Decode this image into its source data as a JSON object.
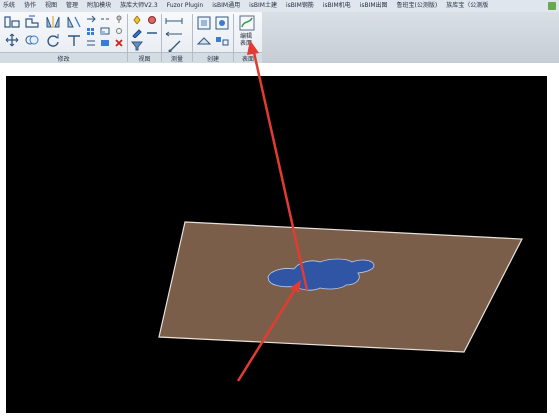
{
  "menu": {
    "items": [
      "乐统",
      "协作",
      "视图",
      "管理",
      "附加模块",
      "族库大师V2.3",
      "Fuzor Plugin",
      "isBIM通用",
      "isBIM土建",
      "isBIM钢筋",
      "isBIM机电",
      "isBIM出图",
      "鲁班宝(公测版)",
      "族库宝（公测版"
    ]
  },
  "ribbon": {
    "groups": {
      "modify": "修改",
      "view": "视图",
      "measure": "测量",
      "create": "创建",
      "mode": "表面"
    },
    "edit_boundary_button": "编辑\n表面"
  },
  "colors": {
    "viewport_background": "#000000",
    "floor_surface": "#7b5e4a",
    "floor_outline": "#e8e2dc",
    "water_region": "#2f55a4",
    "annotation_arrow": "#e23b32"
  },
  "icons": [
    "align-icon",
    "offset-icon",
    "mirror-icon",
    "move-icon",
    "copy-icon",
    "rotate-icon",
    "trim-icon",
    "split-icon",
    "array-icon",
    "scale-icon",
    "pin-icon",
    "delete-icon",
    "paint-icon",
    "hide-icon",
    "measure-icon",
    "create-icon",
    "edit-boundary-icon"
  ]
}
